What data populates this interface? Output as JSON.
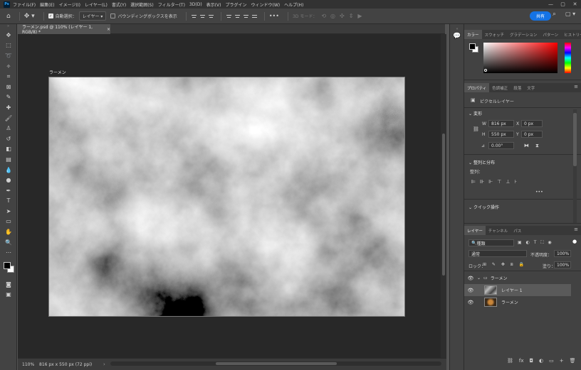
{
  "app": {
    "logo": "Ps"
  },
  "menu": [
    "ファイル(F)",
    "編集(E)",
    "イメージ(I)",
    "レイヤー(L)",
    "書式(Y)",
    "選択範囲(S)",
    "フィルター(T)",
    "3D(D)",
    "表示(V)",
    "プラグイン",
    "ウィンドウ(W)",
    "ヘルプ(H)"
  ],
  "window_controls": {
    "minimize": "—",
    "maximize": "▢",
    "close": "✕"
  },
  "options": {
    "auto_select_label": "自動選択：",
    "auto_select_value": "レイヤー",
    "bounding_box_label": "バウンディングボックスを表示",
    "mode3d_label": "3D モード：",
    "share_label": "共有"
  },
  "document": {
    "tab_title": "ラーメン.psd @ 110% (レイヤー 1, RGB/8) *",
    "tab_close": "×",
    "artboard_label": "ラーメン",
    "zoom": "110%",
    "size_info": "816 px x 550 px (72 ppi)"
  },
  "color_panel": {
    "tabs": [
      "カラー",
      "スウォッチ",
      "グラデーション",
      "パターン",
      "ヒストリー"
    ]
  },
  "properties_panel": {
    "tabs": [
      "プロパティ",
      "色調補正",
      "段落",
      "文字"
    ],
    "type": "ピクセルレイヤー",
    "transform_title": "変形",
    "w_label": "W",
    "w_value": "816 px",
    "x_label": "X",
    "x_value": "0 px",
    "h_label": "H",
    "h_value": "550 px",
    "y_label": "Y",
    "y_value": "0 px",
    "angle_value": "0.00°",
    "align_title": "整列と分布",
    "align_label": "整列：",
    "more": "•••",
    "quick_title": "クイック操作"
  },
  "layers_panel": {
    "tabs": [
      "レイヤー",
      "チャンネル",
      "パス"
    ],
    "filter_label": "種類",
    "blend_mode": "通常",
    "opacity_label": "不透明度：",
    "opacity_value": "100%",
    "lock_label": "ロック：",
    "fill_label": "塗り：",
    "fill_value": "100%",
    "group_name": "ラーメン",
    "layer1_name": "レイヤー 1",
    "layer2_name": "ラーメン",
    "bottom_icons": [
      "fx",
      "◘",
      "◐",
      "▭",
      "+",
      "🗑"
    ]
  }
}
